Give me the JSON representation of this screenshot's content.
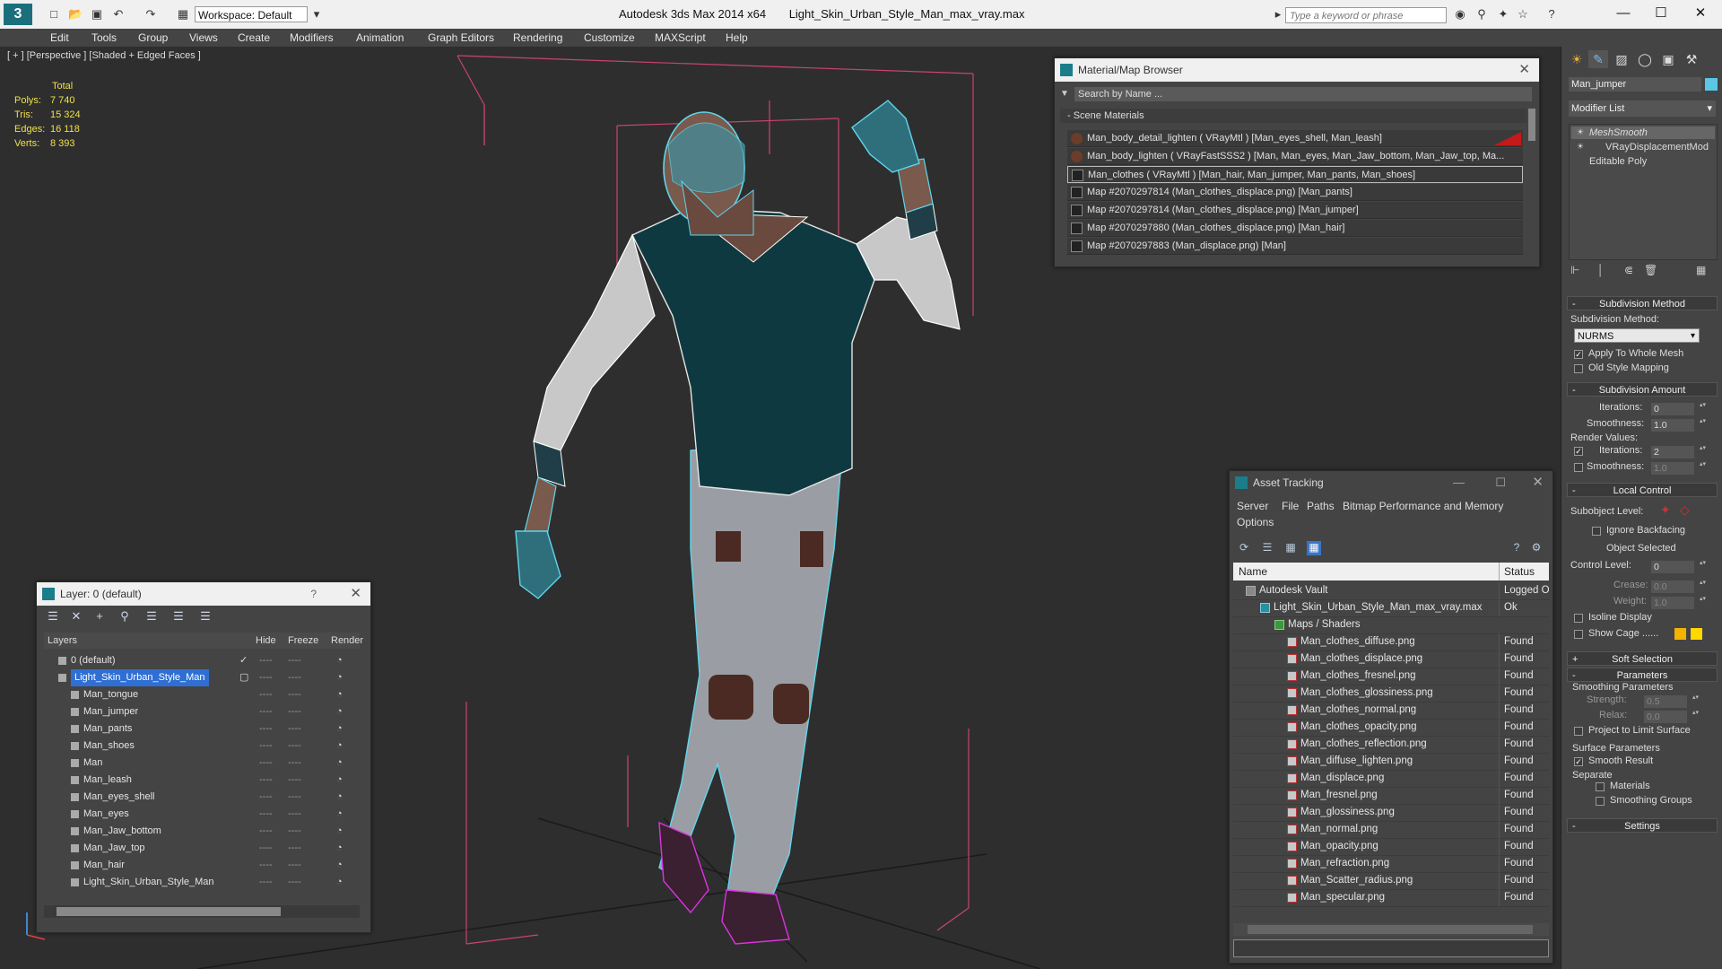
{
  "app": {
    "title_app": "Autodesk 3ds Max  2014 x64",
    "title_file": "Light_Skin_Urban_Style_Man_max_vray.max",
    "workspace": "Workspace: Default",
    "search_placeholder": "Type a keyword or phrase"
  },
  "menu": [
    "Edit",
    "Tools",
    "Group",
    "Views",
    "Create",
    "Modifiers",
    "Animation",
    "Graph Editors",
    "Rendering",
    "Customize",
    "MAXScript",
    "Help"
  ],
  "viewport": {
    "label": "[ + ] [Perspective ] [Shaded + Edged Faces ]",
    "stats_header": "Total",
    "stats": [
      {
        "k": "Polys:",
        "v": "7 740"
      },
      {
        "k": "Tris:",
        "v": "15 324"
      },
      {
        "k": "Edges:",
        "v": "16 118"
      },
      {
        "k": "Verts:",
        "v": "8 393"
      }
    ]
  },
  "material_browser": {
    "title": "Material/Map Browser",
    "search": "Search by Name ...",
    "section": "- Scene Materials",
    "rows": [
      {
        "text": "Man_body_detail_lighten  ( VRayMtl ) [Man_eyes_shell, Man_leash]",
        "kind": "mat"
      },
      {
        "text": "Man_body_lighten  ( VRayFastSSS2 ) [Man, Man_eyes, Man_Jaw_bottom, Man_Jaw_top, Ma...",
        "kind": "mat"
      },
      {
        "text": "Man_clothes  ( VRayMtl ) [Man_hair, Man_jumper, Man_pants, Man_shoes]",
        "kind": "map"
      },
      {
        "text": "Map #2070297814 (Man_clothes_displace.png) [Man_pants]",
        "kind": "map"
      },
      {
        "text": "Map #2070297814 (Man_clothes_displace.png) [Man_jumper]",
        "kind": "map"
      },
      {
        "text": "Map #2070297880 (Man_clothes_displace.png) [Man_hair]",
        "kind": "map"
      },
      {
        "text": "Map #2070297883 (Man_displace.png) [Man]",
        "kind": "map"
      }
    ]
  },
  "layers": {
    "title": "Layer: 0 (default)",
    "help": "?",
    "columns": [
      "Layers",
      "Hide",
      "Freeze",
      "Render"
    ],
    "rows": [
      {
        "name": "0 (default)",
        "level": 0
      },
      {
        "name": "Light_Skin_Urban_Style_Man",
        "level": 0
      },
      {
        "name": "Man_tongue",
        "level": 1
      },
      {
        "name": "Man_jumper",
        "level": 1
      },
      {
        "name": "Man_pants",
        "level": 1
      },
      {
        "name": "Man_shoes",
        "level": 1
      },
      {
        "name": "Man",
        "level": 1
      },
      {
        "name": "Man_leash",
        "level": 1
      },
      {
        "name": "Man_eyes_shell",
        "level": 1
      },
      {
        "name": "Man_eyes",
        "level": 1
      },
      {
        "name": "Man_Jaw_bottom",
        "level": 1
      },
      {
        "name": "Man_Jaw_top",
        "level": 1
      },
      {
        "name": "Man_hair",
        "level": 1
      },
      {
        "name": "Light_Skin_Urban_Style_Man",
        "level": 1
      }
    ],
    "dash": "----"
  },
  "asset_tracking": {
    "title": "Asset Tracking",
    "menu_row1": [
      "Server",
      "File",
      "Paths",
      "Bitmap Performance and Memory"
    ],
    "menu_row2": [
      "Options"
    ],
    "columns": [
      "Name",
      "Status"
    ],
    "rows": [
      {
        "name": "Autodesk Vault",
        "status": "Logged O",
        "level": 0
      },
      {
        "name": "Light_Skin_Urban_Style_Man_max_vray.max",
        "status": "Ok",
        "level": 1
      },
      {
        "name": "Maps / Shaders",
        "status": "",
        "level": 2
      },
      {
        "name": "Man_clothes_diffuse.png",
        "status": "Found",
        "level": 3
      },
      {
        "name": "Man_clothes_displace.png",
        "status": "Found",
        "level": 3
      },
      {
        "name": "Man_clothes_fresnel.png",
        "status": "Found",
        "level": 3
      },
      {
        "name": "Man_clothes_glossiness.png",
        "status": "Found",
        "level": 3
      },
      {
        "name": "Man_clothes_normal.png",
        "status": "Found",
        "level": 3
      },
      {
        "name": "Man_clothes_opacity.png",
        "status": "Found",
        "level": 3
      },
      {
        "name": "Man_clothes_reflection.png",
        "status": "Found",
        "level": 3
      },
      {
        "name": "Man_diffuse_lighten.png",
        "status": "Found",
        "level": 3
      },
      {
        "name": "Man_displace.png",
        "status": "Found",
        "level": 3
      },
      {
        "name": "Man_fresnel.png",
        "status": "Found",
        "level": 3
      },
      {
        "name": "Man_glossiness.png",
        "status": "Found",
        "level": 3
      },
      {
        "name": "Man_normal.png",
        "status": "Found",
        "level": 3
      },
      {
        "name": "Man_opacity.png",
        "status": "Found",
        "level": 3
      },
      {
        "name": "Man_refraction.png",
        "status": "Found",
        "level": 3
      },
      {
        "name": "Man_Scatter_radius.png",
        "status": "Found",
        "level": 3
      },
      {
        "name": "Man_specular.png",
        "status": "Found",
        "level": 3
      }
    ]
  },
  "command_panel": {
    "object_name": "Man_jumper",
    "object_color": "#5bc6e6",
    "modifier_list": "Modifier List",
    "stack": [
      "MeshSmooth",
      "VRayDisplacementMod",
      "Editable Poly"
    ],
    "subdivision_method": {
      "rollout": "Subdivision Method",
      "label": "Subdivision Method:",
      "value": "NURMS",
      "apply_whole_mesh": "Apply To Whole Mesh",
      "old_style": "Old Style Mapping"
    },
    "subdivision_amount": {
      "rollout": "Subdivision Amount",
      "iterations_label": "Iterations:",
      "iterations": "0",
      "smoothness_label": "Smoothness:",
      "smoothness": "1.0",
      "render_values": "Render Values:",
      "r_iterations_label": "Iterations:",
      "r_iterations": "2",
      "r_smoothness_label": "Smoothness:",
      "r_smoothness": "1.0"
    },
    "local_control": {
      "rollout": "Local Control",
      "subobject_label": "Subobject Level:",
      "ignore_backfacing": "Ignore Backfacing",
      "object_selected": "Object Selected",
      "control_level_label": "Control Level:",
      "control_level": "0",
      "crease_label": "Crease:",
      "crease": "0.0",
      "weight_label": "Weight:",
      "weight": "1.0",
      "isoline": "Isoline Display",
      "show_cage": "Show Cage ......"
    },
    "soft_selection": "Soft Selection",
    "parameters": {
      "rollout": "Parameters",
      "smoothing_params": "Smoothing Parameters",
      "strength_label": "Strength:",
      "strength": "0.5",
      "relax_label": "Relax:",
      "relax": "0.0",
      "project_limit": "Project to Limit Surface",
      "surface_params": "Surface Parameters",
      "smooth_result": "Smooth Result",
      "separate": "Separate",
      "materials": "Materials",
      "smoothing_groups": "Smoothing Groups"
    },
    "settings": "Settings"
  }
}
